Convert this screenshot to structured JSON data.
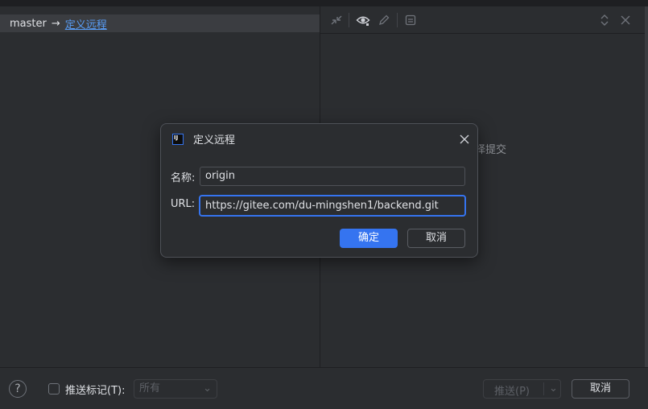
{
  "branch": {
    "local": "master",
    "arrow": "→",
    "remote_link": "定义远程"
  },
  "right_panel": {
    "placeholder": "择提交"
  },
  "toolbar": {
    "icons": [
      "collapse-icon",
      "eye-icon",
      "pencil-icon",
      "layout-icon",
      "expand-collapse-icon",
      "close-icon"
    ]
  },
  "dialog": {
    "title": "定义远程",
    "name_label": "名称:",
    "name_value": "origin",
    "url_label": "URL:",
    "url_value": "https://gitee.com/du-mingshen1/backend.git",
    "ok_label": "确定",
    "cancel_label": "取消",
    "logo_text": "IJ"
  },
  "footer": {
    "help_glyph": "?",
    "push_tags_label": "推送标记(T):",
    "tags_select_value": "所有",
    "push_label": "推送(P)",
    "cancel_label": "取消"
  },
  "colors": {
    "accent": "#3574f0",
    "link": "#589df6",
    "background": "#2b2d30"
  }
}
